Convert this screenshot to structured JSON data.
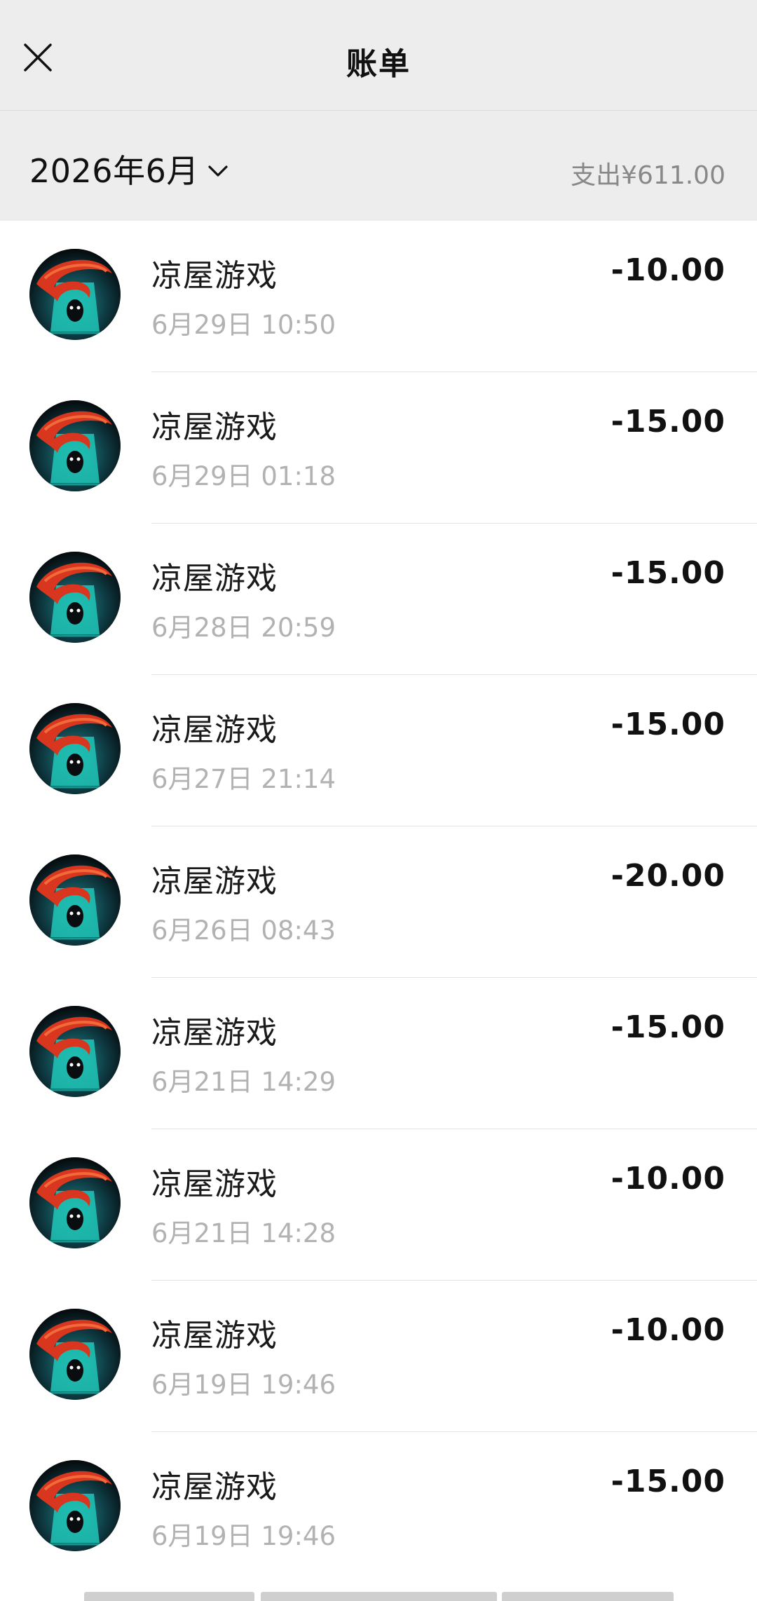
{
  "header": {
    "title": "账单",
    "close_icon": "close-icon"
  },
  "filter": {
    "month_label": "2026年6月",
    "summary": "支出¥611.00",
    "chevron_icon": "chevron-down-icon"
  },
  "transactions": [
    {
      "merchant": "凉屋游戏",
      "time": "6月29日 10:50",
      "amount": "-10.00"
    },
    {
      "merchant": "凉屋游戏",
      "time": "6月29日 01:18",
      "amount": "-15.00"
    },
    {
      "merchant": "凉屋游戏",
      "time": "6月28日 20:59",
      "amount": "-15.00"
    },
    {
      "merchant": "凉屋游戏",
      "time": "6月27日 21:14",
      "amount": "-15.00"
    },
    {
      "merchant": "凉屋游戏",
      "time": "6月26日 08:43",
      "amount": "-20.00"
    },
    {
      "merchant": "凉屋游戏",
      "time": "6月21日 14:29",
      "amount": "-15.00"
    },
    {
      "merchant": "凉屋游戏",
      "time": "6月21日 14:28",
      "amount": "-10.00"
    },
    {
      "merchant": "凉屋游戏",
      "time": "6月19日 19:46",
      "amount": "-10.00"
    },
    {
      "merchant": "凉屋游戏",
      "time": "6月19日 19:46",
      "amount": "-15.00"
    }
  ],
  "colors": {
    "header_bg": "#ededed",
    "secondary_text": "#b2b2b2",
    "summary_text": "#888888"
  }
}
